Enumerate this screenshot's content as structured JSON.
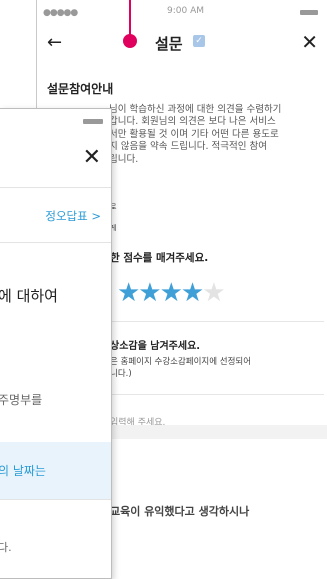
{
  "back": {
    "status": {
      "signal": "●●●●● ",
      "time": "9:00 AM"
    },
    "header": {
      "title": "설문"
    },
    "intro_title": "설문참여안내",
    "intro_text": "님이 학습하신 과정에 대한 의견을 수렴하기\n갑니다. 회원님의 의견은 보다 나은 서비스\n서만 활용될 것 이며 기타 어떤 다른 용도로\n지 않음을 약속 드립니다. 적극적인 참여\n립니다.",
    "small1": "로",
    "small2": "게",
    "q1": "한 점수를 매겨주세요.",
    "stars": {
      "filled": 4,
      "total": 5,
      "on": "★★★★",
      "off": "★"
    },
    "q2": "상소감을 남겨주세요.",
    "q2_note": "은 홈페이지 수강소감페이지에 선정되어\n니다.)",
    "placeholder": "입력해 주세요.",
    "bottom_text": "교육이 유익했다고 생각하시나"
  },
  "front": {
    "answer_link": "정오답표 >",
    "question": "에 대하여",
    "option1": "주명부를",
    "option2": "의 날짜는",
    "option3": "다."
  },
  "colors": {
    "pointer": "#e0005e",
    "accent": "#2a9bd6",
    "star_on": "#3fa0d8"
  }
}
